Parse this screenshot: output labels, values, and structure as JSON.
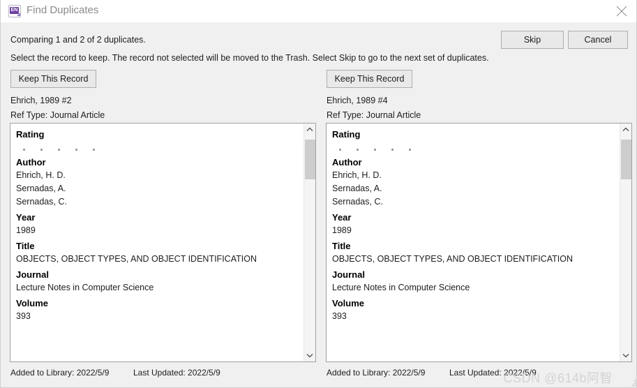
{
  "window": {
    "title": "Find Duplicates",
    "app_icon": "endnote-icon",
    "app_icon_text": "EN",
    "close_icon": "close-icon"
  },
  "instructions": {
    "comparing": "Comparing 1 and 2 of 2 duplicates.",
    "select": "Select the record to keep. The record not selected will be moved to the Trash. Select Skip to go to the next set of duplicates."
  },
  "toolbar": {
    "skip_label": "Skip",
    "cancel_label": "Cancel"
  },
  "records": [
    {
      "keep_label": "Keep This Record",
      "citation": "Ehrich, 1989 #2",
      "ref_type": "Ref Type: Journal Article",
      "rating": 0,
      "rating_max": 5,
      "fields": [
        {
          "label": "Rating",
          "value": ""
        },
        {
          "label": "Author",
          "value": "Ehrich, H. D.\nSernadas, A.\nSernadas, C."
        },
        {
          "label": "Year",
          "value": "1989"
        },
        {
          "label": "Title",
          "value": "OBJECTS, OBJECT TYPES, AND OBJECT IDENTIFICATION"
        },
        {
          "label": "Journal",
          "value": "Lecture Notes in Computer Science"
        },
        {
          "label": "Volume",
          "value": "393"
        }
      ],
      "authors": [
        "Ehrich, H. D.",
        "Sernadas, A.",
        "Sernadas, C."
      ],
      "labels": {
        "rating": "Rating",
        "author": "Author",
        "year": "Year",
        "title": "Title",
        "journal": "Journal",
        "volume": "Volume"
      },
      "values": {
        "year": "1989",
        "title": "OBJECTS, OBJECT TYPES, AND OBJECT IDENTIFICATION",
        "journal": "Lecture Notes in Computer Science",
        "volume": "393"
      },
      "footer": {
        "added": "Added to Library: 2022/5/9",
        "updated": "Last Updated: 2022/5/9"
      }
    },
    {
      "keep_label": "Keep This Record",
      "citation": "Ehrich, 1989 #4",
      "ref_type": "Ref Type: Journal Article",
      "rating": 0,
      "rating_max": 5,
      "fields": [
        {
          "label": "Rating",
          "value": ""
        },
        {
          "label": "Author",
          "value": "Ehrich, H. D.\nSernadas, A.\nSernadas, C."
        },
        {
          "label": "Year",
          "value": "1989"
        },
        {
          "label": "Title",
          "value": "OBJECTS, OBJECT TYPES, AND OBJECT IDENTIFICATION"
        },
        {
          "label": "Journal",
          "value": "Lecture Notes in Computer Science"
        },
        {
          "label": "Volume",
          "value": "393"
        }
      ],
      "authors": [
        "Ehrich, H. D.",
        "Sernadas, A.",
        "Sernadas, C."
      ],
      "labels": {
        "rating": "Rating",
        "author": "Author",
        "year": "Year",
        "title": "Title",
        "journal": "Journal",
        "volume": "Volume"
      },
      "values": {
        "year": "1989",
        "title": "OBJECTS, OBJECT TYPES, AND OBJECT IDENTIFICATION",
        "journal": "Lecture Notes in Computer Science",
        "volume": "393"
      },
      "footer": {
        "added": "Added to Library: 2022/5/9",
        "updated": "Last Updated: 2022/5/9"
      }
    }
  ],
  "watermark": "CSDN @614b阿智",
  "colors": {
    "window_bg": "#f0f0f0",
    "titlebar_bg": "#ffffff",
    "title_text": "#8a8a8a",
    "button_bg": "#e9e9e9",
    "button_border": "#adadad",
    "panel_bg": "#ffffff",
    "panel_border": "#a0a0a0",
    "text": "#1d1d1d",
    "scroll_thumb": "#cdcdcd",
    "rating_dot": "#8d8d8d",
    "accent_purple": "#6b3fa0",
    "watermark": "#d3d3d3"
  }
}
